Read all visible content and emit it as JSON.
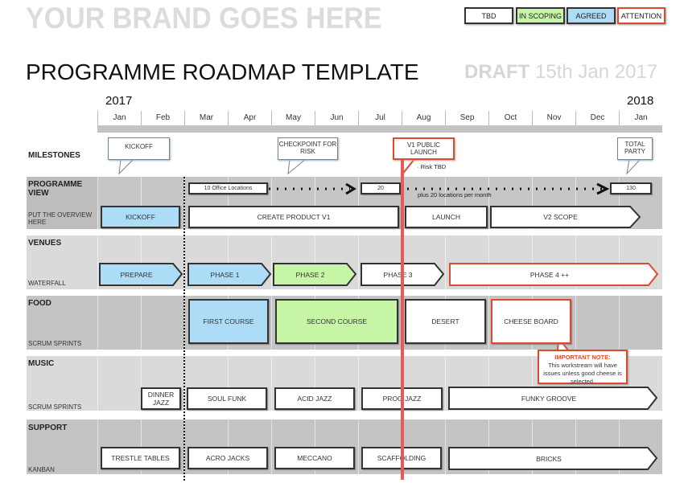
{
  "header": {
    "brand": "YOUR BRAND GOES HERE",
    "title": "PROGRAMME ROADMAP TEMPLATE",
    "draft_label": "DRAFT",
    "draft_date": "15th Jan 2017"
  },
  "legend": [
    {
      "label": "TBD",
      "color": "#ffffff",
      "border": "#333333"
    },
    {
      "label": "IN SCOPING",
      "color": "#c6f5a6",
      "border": "#333333"
    },
    {
      "label": "AGREED",
      "color": "#acdcf6",
      "border": "#333333"
    },
    {
      "label": "ATTENTION",
      "color": "#ffffff",
      "border": "#e04a2c"
    }
  ],
  "timeline": {
    "year_start": "2017",
    "year_end": "2018",
    "months": [
      "Jan",
      "Feb",
      "Mar",
      "Apr",
      "May",
      "Jun",
      "Jul",
      "Aug",
      "Sep",
      "Oct",
      "Nov",
      "Dec",
      "Jan"
    ],
    "today_marker_color": "#e8595a"
  },
  "milestones": {
    "label": "MILESTONES",
    "items": [
      {
        "label": "KICKOFF"
      },
      {
        "label": "CHECKPOINT FOR RISK"
      },
      {
        "label": "V1 PUBLIC LAUNCH",
        "note": "Risk TBD"
      },
      {
        "label": "TOTAL PARTY"
      }
    ]
  },
  "programme": {
    "label": "PROGRAMME VIEW",
    "sublabel": "PUT THE OVERVIEW HERE",
    "counters": [
      {
        "label": "10 Office Locations"
      },
      {
        "label": "20"
      },
      {
        "label": "130"
      }
    ],
    "counter_note": "plus 20 locations per month",
    "bars": [
      {
        "label": "KICKOFF",
        "status": "agreed"
      },
      {
        "label": "CREATE PRODUCT V1",
        "status": "tbd"
      },
      {
        "label": "LAUNCH",
        "status": "tbd"
      },
      {
        "label": "V2 SCOPE",
        "status": "tbd"
      }
    ]
  },
  "venues": {
    "label": "VENUES",
    "sublabel": "WATERFALL",
    "bars": [
      {
        "label": "PREPARE",
        "status": "agreed"
      },
      {
        "label": "PHASE 1",
        "status": "agreed"
      },
      {
        "label": "PHASE 2",
        "status": "in-scoping"
      },
      {
        "label": "PHASE 3",
        "status": "tbd"
      },
      {
        "label": "PHASE 4 ++",
        "status": "attention"
      }
    ]
  },
  "food": {
    "label": "FOOD",
    "sublabel": "SCRUM SPRINTS",
    "bars": [
      {
        "label": "FIRST COURSE",
        "status": "agreed"
      },
      {
        "label": "SECOND COURSE",
        "status": "in-scoping"
      },
      {
        "label": "DESERT",
        "status": "tbd"
      },
      {
        "label": "CHEESE BOARD",
        "status": "attention"
      }
    ],
    "note_title": "IMPORTANT  NOTE:",
    "note_body": "This workstream will have issues unless good cheese is selected."
  },
  "music": {
    "label": "MUSIC",
    "sublabel": "SCRUM SPRINTS",
    "bars": [
      {
        "label": "DINNER JAZZ"
      },
      {
        "label": "SOUL FUNK"
      },
      {
        "label": "ACID JAZZ"
      },
      {
        "label": "PROG JAZZ"
      },
      {
        "label": "FUNKY GROOVE"
      }
    ]
  },
  "support": {
    "label": "SUPPORT",
    "sublabel": "KANBAN",
    "bars": [
      {
        "label": "TRESTLE TABLES"
      },
      {
        "label": "ACRO JACKS"
      },
      {
        "label": "MECCANO"
      },
      {
        "label": "SCAFFOLDING"
      },
      {
        "label": "BRICKS"
      }
    ]
  }
}
